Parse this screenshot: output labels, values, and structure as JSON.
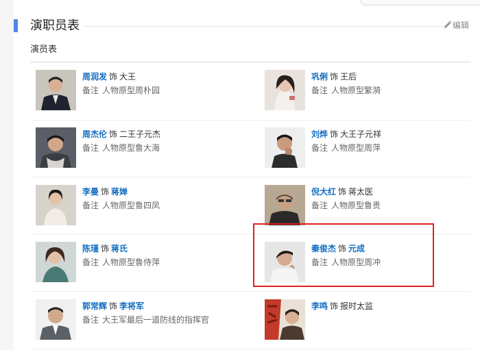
{
  "section": {
    "title": "演职员表",
    "edit_label": "编辑",
    "subheading": "演员表"
  },
  "cast": [
    {
      "actor": "周润发",
      "as": "饰",
      "role": "大王",
      "role_is_link": false,
      "note_label": "备注",
      "note": "人物原型周朴园"
    },
    {
      "actor": "巩俐",
      "as": "饰",
      "role": "王后",
      "role_is_link": false,
      "note_label": "备注",
      "note": "人物原型繁漪"
    },
    {
      "actor": "周杰伦",
      "as": "饰",
      "role": "二王子元杰",
      "role_is_link": false,
      "note_label": "备注",
      "note": "人物原型鲁大海"
    },
    {
      "actor": "刘烨",
      "as": "饰",
      "role": "大王子元祥",
      "role_is_link": false,
      "note_label": "备注",
      "note": "人物原型周萍"
    },
    {
      "actor": "李曼",
      "as": "饰",
      "role": "蒋婵",
      "role_is_link": true,
      "note_label": "备注",
      "note": "人物原型鲁四凤"
    },
    {
      "actor": "倪大红",
      "as": "饰",
      "role": "蒋太医",
      "role_is_link": false,
      "note_label": "备注",
      "note": "人物原型鲁贵"
    },
    {
      "actor": "陈瑾",
      "as": "饰",
      "role": "蒋氏",
      "role_is_link": true,
      "note_label": "备注",
      "note": "人物原型鲁侍萍"
    },
    {
      "actor": "秦俊杰",
      "as": "饰",
      "role": "元成",
      "role_is_link": true,
      "note_label": "备注",
      "note": "人物原型周冲"
    },
    {
      "actor": "郭常辉",
      "as": "饰",
      "role": "李将军",
      "role_is_link": true,
      "note_label": "备注",
      "note": "大王军最后一道防线的指挥官"
    },
    {
      "actor": "李鸣",
      "as": "饰",
      "role": "报时太监",
      "role_is_link": false,
      "note_label": "",
      "note": ""
    }
  ],
  "colors": {
    "accent": "#4e8ae6",
    "link": "#136ec2",
    "highlight": "#e02020"
  }
}
